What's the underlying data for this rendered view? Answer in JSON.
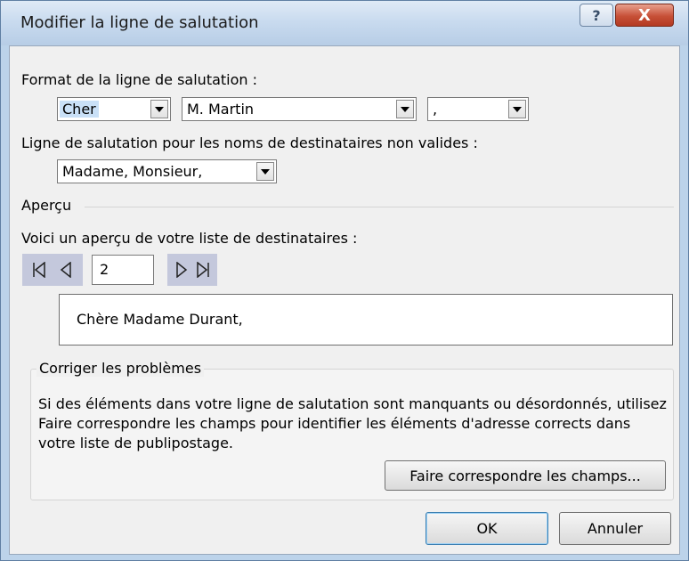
{
  "window": {
    "title": "Modifier la ligne de salutation",
    "help_label": "?",
    "close_label": "X"
  },
  "format": {
    "label": "Format de la ligne de salutation :",
    "greeting_value": "Cher",
    "name_value": "M. Martin",
    "punct_value": ","
  },
  "invalid": {
    "label": "Ligne de salutation pour les noms de destinataires non valides :",
    "value": "Madame, Monsieur,"
  },
  "preview": {
    "section_label": "Aperçu",
    "desc": "Voici un aperçu de votre liste de destinataires :",
    "record_number": "2",
    "text": "Chère Madame Durant,"
  },
  "problems": {
    "legend": "Corriger les problèmes",
    "text": "Si des éléments dans votre ligne de salutation sont manquants ou désordonnés, utilisez Faire correspondre les champs pour identifier les éléments d'adresse corrects dans votre liste de publipostage.",
    "match_button": "Faire correspondre les champs..."
  },
  "buttons": {
    "ok": "OK",
    "cancel": "Annuler"
  }
}
